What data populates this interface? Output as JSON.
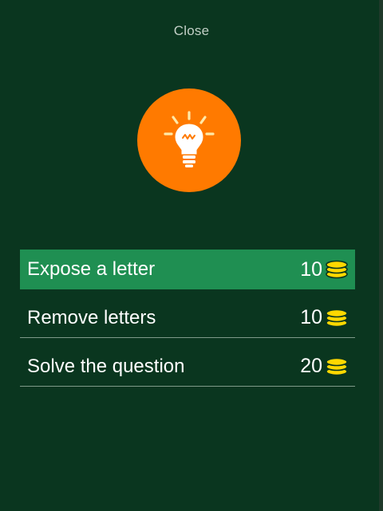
{
  "dialog": {
    "close_label": "Close",
    "icon": "lightbulb-icon",
    "colors": {
      "background": "#0a361f",
      "bulb_circle": "#ff7a00",
      "selected_row": "#1f8f52",
      "coin": "#ffd800"
    }
  },
  "hints": [
    {
      "label": "Expose a letter",
      "cost": "10",
      "selected": true
    },
    {
      "label": "Remove letters",
      "cost": "10",
      "selected": false
    },
    {
      "label": "Solve the question",
      "cost": "20",
      "selected": false
    }
  ]
}
